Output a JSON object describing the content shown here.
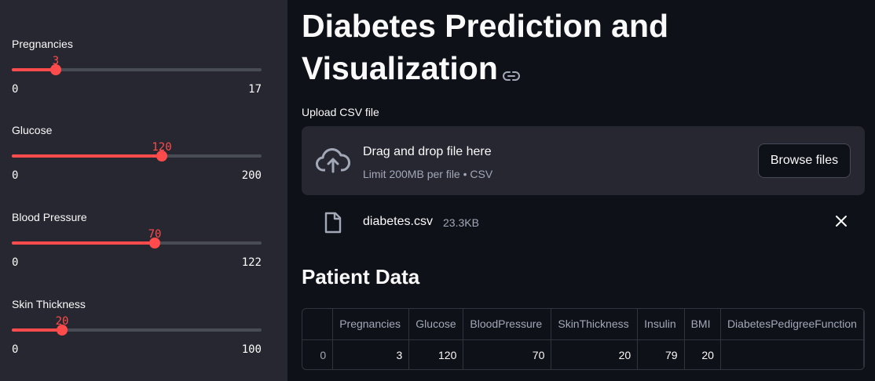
{
  "sidebar": {
    "sliders": [
      {
        "label": "Pregnancies",
        "value": "3",
        "min": "0",
        "max": "17",
        "fraction": 0.176
      },
      {
        "label": "Glucose",
        "value": "120",
        "min": "0",
        "max": "200",
        "fraction": 0.6
      },
      {
        "label": "Blood Pressure",
        "value": "70",
        "min": "0",
        "max": "122",
        "fraction": 0.574
      },
      {
        "label": "Skin Thickness",
        "value": "20",
        "min": "0",
        "max": "100",
        "fraction": 0.2
      }
    ]
  },
  "main": {
    "title": "Diabetes Prediction and Visualization",
    "title_icon": "link-icon",
    "upload": {
      "label": "Upload CSV file",
      "drop_title": "Drag and drop file here",
      "drop_sub": "Limit 200MB per file • CSV",
      "browse_label": "Browse files",
      "icon": "cloud-upload-icon"
    },
    "file": {
      "name": "diabetes.csv",
      "size": "23.3KB",
      "icon": "file-icon",
      "remove_icon": "close-icon"
    },
    "section_title": "Patient Data",
    "table": {
      "headers": [
        "",
        "Pregnancies",
        "Glucose",
        "BloodPressure",
        "SkinThickness",
        "Insulin",
        "BMI",
        "DiabetesPedigreeFunction"
      ],
      "rows": [
        [
          "0",
          "3",
          "120",
          "70",
          "20",
          "79",
          "20",
          ""
        ]
      ]
    }
  },
  "colors": {
    "accent": "#ff4b4b",
    "sidebar_bg": "#262730",
    "main_bg": "#0e1117"
  }
}
